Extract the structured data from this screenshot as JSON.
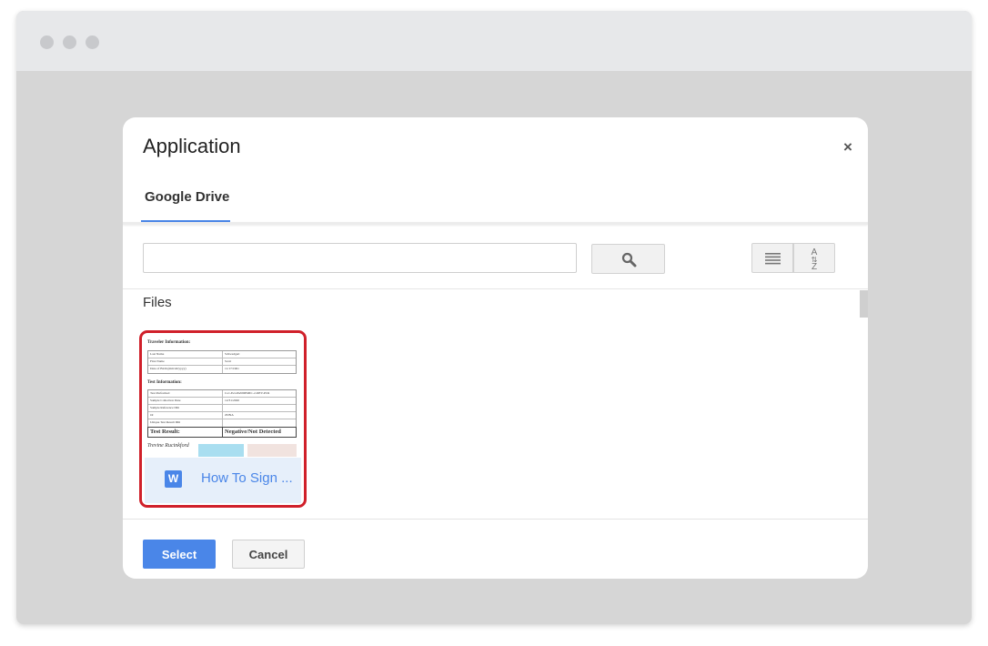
{
  "window": {
    "controls": [
      "window-dot",
      "window-dot",
      "window-dot"
    ]
  },
  "dialog": {
    "title": "Application",
    "close_label": "×",
    "tabs": [
      {
        "label": "Google Drive",
        "active": true
      }
    ],
    "search": {
      "value": "",
      "placeholder": ""
    },
    "icons": {
      "search": "magnifier-icon",
      "list_view": "list-view-icon",
      "sort": "sort-az-icon"
    },
    "sort_label_top": "A",
    "sort_label_bottom": "Z",
    "section_label": "Files",
    "files": [
      {
        "name": "How To Sign ...",
        "type_badge": "W",
        "selected": true,
        "thumbnail": {
          "traveler_header": "Traveler Information:",
          "traveler_rows": [
            [
              "Last Name",
              "Schwedgert"
            ],
            [
              "First Name",
              "Scott"
            ],
            [
              "Date of Birth (mm/dd/yyyy)",
              "11/17/1961"
            ]
          ],
          "test_header": "Test Information:",
          "test_rows": [
            [
              "Test Performed",
              "Cov-Ezi-PANDEMIC-2-DEV-PCR"
            ],
            [
              "Sample Collection Date",
              "12/31/2020"
            ],
            [
              "Sample Reference ID#",
              ""
            ],
            [
              "Or",
              "ZDNA"
            ],
            [
              "Unique Test Result ID#",
              ""
            ]
          ],
          "result_label": "Test Result:",
          "result_value": "Negative/Not Detected",
          "signature": "Trevine Rucinkford"
        }
      }
    ],
    "buttons": {
      "select": "Select",
      "cancel": "Cancel"
    },
    "colors": {
      "primary": "#4a86e8",
      "selection_border": "#d0202a"
    }
  }
}
